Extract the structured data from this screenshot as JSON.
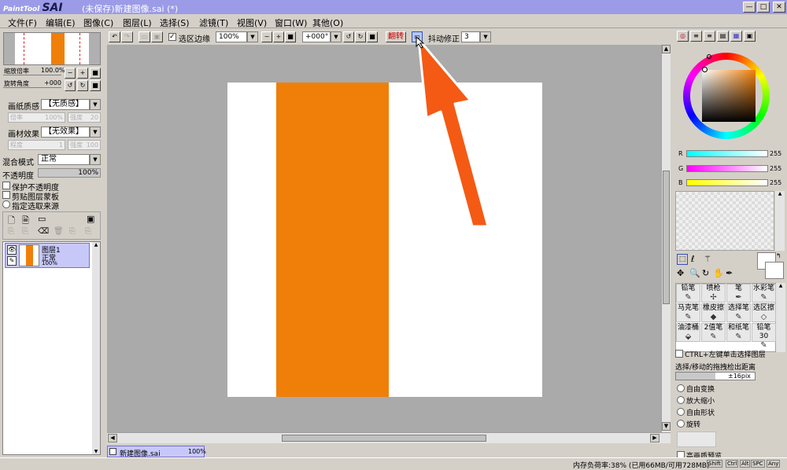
{
  "title": {
    "logo_small": "PaintTool",
    "logo_big": "SAI",
    "document": "(未保存)新建图像.sai (*)",
    "min": "—",
    "max": "□",
    "close": "✕"
  },
  "menu": [
    "文件(F)",
    "编辑(E)",
    "图像(C)",
    "图层(L)",
    "选择(S)",
    "滤镜(T)",
    "视图(V)",
    "窗口(W)",
    "其他(O)"
  ],
  "toolbar": {
    "selection_edge": "选区边缘",
    "zoom": "100%",
    "rotation": "+000°",
    "flip": "翻转",
    "stabilizer_label": "抖动修正",
    "stabilizer_value": "3"
  },
  "navigator": {
    "zoom_label": "缩放倍率",
    "zoom_value": "100.0%",
    "angle_label": "旋转角度",
    "angle_value": "+000"
  },
  "paper_texture": {
    "label": "画纸质感",
    "value": "【无质感】",
    "scale_label": "倍率",
    "scale_value": "100%",
    "strength_label": "强度",
    "strength_value": "20"
  },
  "paper_effect": {
    "label": "画材效果",
    "value": "【无效果】",
    "degree_label": "程度",
    "degree_value": "1",
    "strength_label": "强度",
    "strength_value": "100"
  },
  "blend": {
    "label": "混合模式",
    "value": "正常"
  },
  "opacity": {
    "label": "不透明度",
    "value": "100%"
  },
  "layer_options": [
    "保护不透明度",
    "剪贴图层蒙板",
    "指定选取来源"
  ],
  "layer": {
    "name": "图层1",
    "mode": "正常",
    "opacity": "100%"
  },
  "doc_tab": {
    "name": "新建图像.sai",
    "zoom": "100%"
  },
  "color": {
    "r_label": "R",
    "r_value": "255",
    "g_label": "G",
    "g_value": "255",
    "b_label": "B",
    "b_value": "255",
    "stripe": "#f07f09"
  },
  "tools": [
    {
      "label": "铅笔",
      "icon": "pencil-icon"
    },
    {
      "label": "喷枪",
      "icon": "airbrush-icon"
    },
    {
      "label": "笔",
      "icon": "pen-icon"
    },
    {
      "label": "水彩笔",
      "icon": "watercolor-icon"
    },
    {
      "label": "马克笔",
      "icon": "marker-icon"
    },
    {
      "label": "橡皮擦",
      "icon": "eraser-icon"
    },
    {
      "label": "选择笔",
      "icon": "select-pen-icon"
    },
    {
      "label": "选区擦",
      "icon": "select-eraser-icon"
    },
    {
      "label": "油漆桶",
      "icon": "bucket-icon"
    },
    {
      "label": "2值笔",
      "icon": "binary-pen-icon"
    },
    {
      "label": "和纸笔",
      "icon": "washi-pen-icon"
    },
    {
      "label": "铅笔30",
      "icon": "pencil30-icon"
    }
  ],
  "options": {
    "ctrl_select": "CTRL+左键单击选择图层",
    "drag_label": "选择/移动的拖拽检出距离",
    "drag_value": "±16pix",
    "free_transform": "自由变换",
    "zoom_out": "放大缩小",
    "free_shape": "自由形状",
    "rotate": "旋转",
    "hq_preview": "高画质预览"
  },
  "status": {
    "memory": "内存负荷率:38% (已用66MB/可用728MB)",
    "keys": [
      "Shift",
      "Ctrl",
      "Alt",
      "SPC",
      "Any"
    ]
  }
}
